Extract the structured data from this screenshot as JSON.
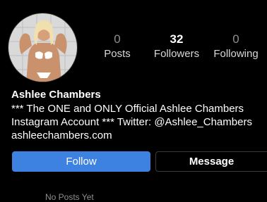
{
  "profile": {
    "name": "Ashlee Chambers",
    "bio_lines": [
      "*** The ONE and ONLY Official Ashlee Chambers",
      "Instagram Account *** Twitter: @Ashlee_Chambers",
      "ashleechambers.com"
    ]
  },
  "stats": {
    "posts": {
      "value": "0",
      "label": "Posts"
    },
    "followers": {
      "value": "32",
      "label": "Followers"
    },
    "following": {
      "value": "0",
      "label": "Following"
    }
  },
  "actions": {
    "follow_label": "Follow",
    "message_label": "Message"
  },
  "footer": {
    "cutoff_text": "No Posts Yet"
  },
  "colors": {
    "background": "#000000",
    "follow_button": "#3d82e0",
    "muted_text": "#8e8e8e"
  }
}
